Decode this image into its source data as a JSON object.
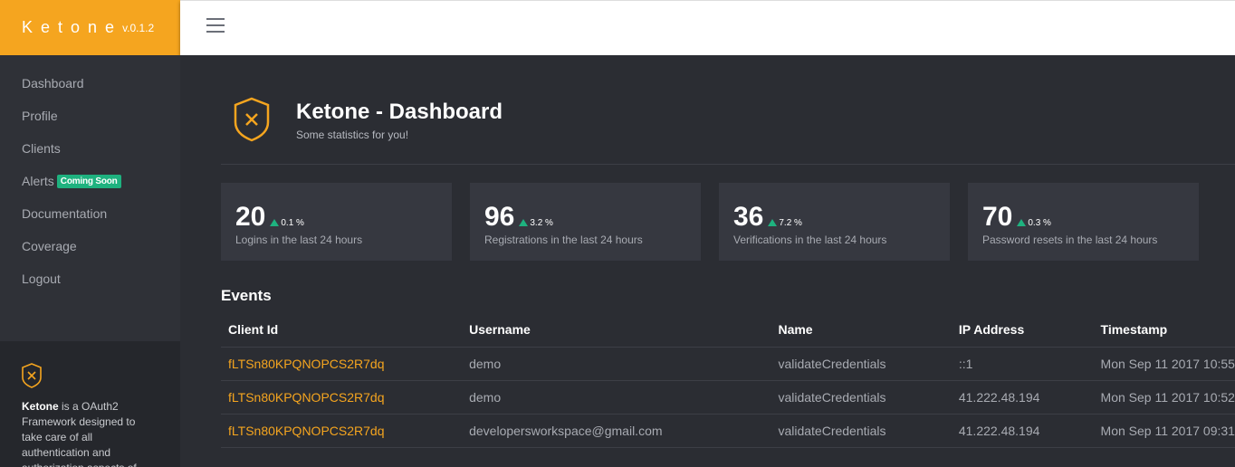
{
  "brand": {
    "name": "Ketone",
    "version": "v.0.1.2"
  },
  "nav": [
    {
      "label": "Dashboard"
    },
    {
      "label": "Profile"
    },
    {
      "label": "Clients"
    },
    {
      "label": "Alerts",
      "badge": "Coming Soon"
    },
    {
      "label": "Documentation"
    },
    {
      "label": "Coverage"
    },
    {
      "label": "Logout"
    }
  ],
  "sidebar_footer": {
    "brand": "Ketone",
    "text": " is a OAuth2 Framework designed to take care of all authentication and authorization aspects of"
  },
  "header": {
    "title": "Ketone - Dashboard",
    "subtitle": "Some statistics for you!"
  },
  "stats": [
    {
      "value": "20",
      "change": "0.1 %",
      "label": "Logins in the last 24 hours"
    },
    {
      "value": "96",
      "change": "3.2 %",
      "label": "Registrations in the last 24 hours"
    },
    {
      "value": "36",
      "change": "7.2 %",
      "label": "Verifications in the last 24 hours"
    },
    {
      "value": "70",
      "change": "0.3 %",
      "label": "Password resets in the last 24 hours"
    }
  ],
  "events": {
    "title": "Events",
    "columns": [
      "Client Id",
      "Username",
      "Name",
      "IP Address",
      "Timestamp"
    ],
    "rows": [
      [
        "fLTSn80KPQNOPCS2R7dq",
        "demo",
        "validateCredentials",
        "::1",
        "Mon Sep 11 2017 10:55"
      ],
      [
        "fLTSn80KPQNOPCS2R7dq",
        "demo",
        "validateCredentials",
        "41.222.48.194",
        "Mon Sep 11 2017 10:52"
      ],
      [
        "fLTSn80KPQNOPCS2R7dq",
        "developersworkspace@gmail.com",
        "validateCredentials",
        "41.222.48.194",
        "Mon Sep 11 2017 09:31"
      ]
    ]
  },
  "colors": {
    "accent": "#f5a51f",
    "positive": "#1eb27f",
    "background": "#2b2d33"
  },
  "icons": {
    "logo": "shield-x-icon",
    "menu": "hamburger-icon",
    "trend": "triangle-up-icon"
  }
}
